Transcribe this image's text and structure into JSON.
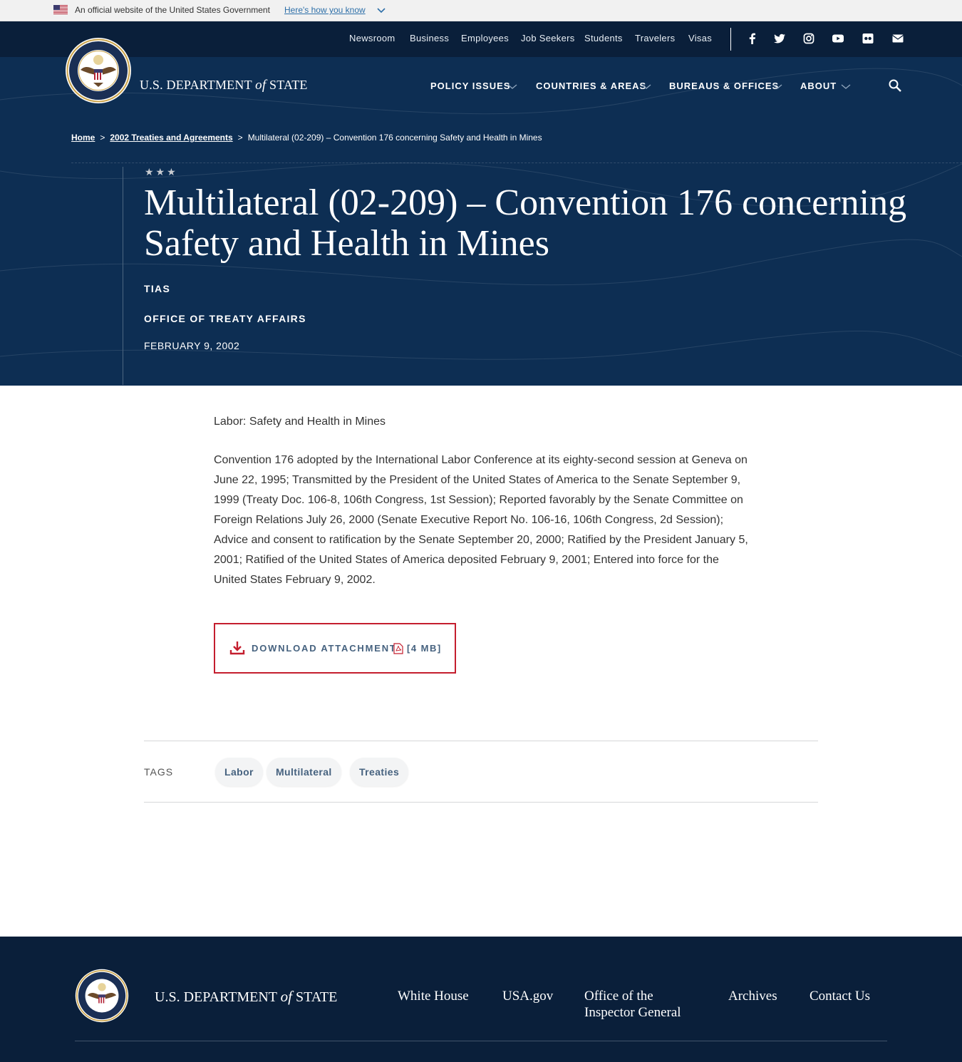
{
  "gov_banner": {
    "text": "An official website of the United States Government",
    "link": "Here's how you know"
  },
  "utility_nav": [
    "Newsroom",
    "Business",
    "Employees",
    "Job Seekers",
    "Students",
    "Travelers",
    "Visas"
  ],
  "social_icons": [
    "facebook-icon",
    "twitter-icon",
    "instagram-icon",
    "youtube-icon",
    "flickr-icon",
    "email-icon"
  ],
  "brand": {
    "dept_prefix": "U.S. DEPARTMENT ",
    "dept_of": "of",
    "dept_suffix": " STATE"
  },
  "main_nav": [
    "POLICY ISSUES",
    "COUNTRIES & AREAS",
    "BUREAUS & OFFICES",
    "ABOUT"
  ],
  "breadcrumb": {
    "home": "Home",
    "parent": "2002 Treaties and Agreements",
    "current": "Multilateral (02-209) – Convention 176 concerning Safety and Health in Mines",
    "separator": ">"
  },
  "hero": {
    "stars": "★★★",
    "title": "Multilateral (02-209) – Convention 176 concerning Safety and Health in Mines",
    "meta_1": "TIAS",
    "meta_2": "OFFICE OF TREATY AFFAIRS",
    "date": "FEBRUARY 9, 2002"
  },
  "content": {
    "summary": "Labor: Safety and Health in Mines",
    "paragraph": "Convention 176 adopted by the International Labor Conference at its eighty-second session at Geneva on June 22, 1995; Transmitted by the President of the United States of America to the Senate September 9, 1999 (Treaty Doc. 106-8, 106th Congress, 1st Session); Reported favorably by the Senate Committee on Foreign Relations July 26, 2000 (Senate Executive Report No. 106-16, 106th Congress, 2d Session); Advice and consent to ratification by the Senate September 20, 2000; Ratified by the President January 5, 2001; Ratified of the United States of America deposited February 9, 2001; Entered into force for the United States February 9, 2002."
  },
  "download": {
    "label": "DOWNLOAD ATTACHMENT",
    "size": "[4 MB]"
  },
  "tags": {
    "label": "TAGS",
    "items": [
      "Labor",
      "Multilateral",
      "Treaties"
    ]
  },
  "footer": {
    "links": [
      "White House",
      "USA.gov",
      "Office of the Inspector General",
      "Archives",
      "Contact Us"
    ]
  },
  "colors": {
    "navy_dark": "#0a1f3a",
    "navy_hero": "#0d2e53",
    "accent_red": "#c41e2e",
    "link_blue": "#46627f"
  }
}
